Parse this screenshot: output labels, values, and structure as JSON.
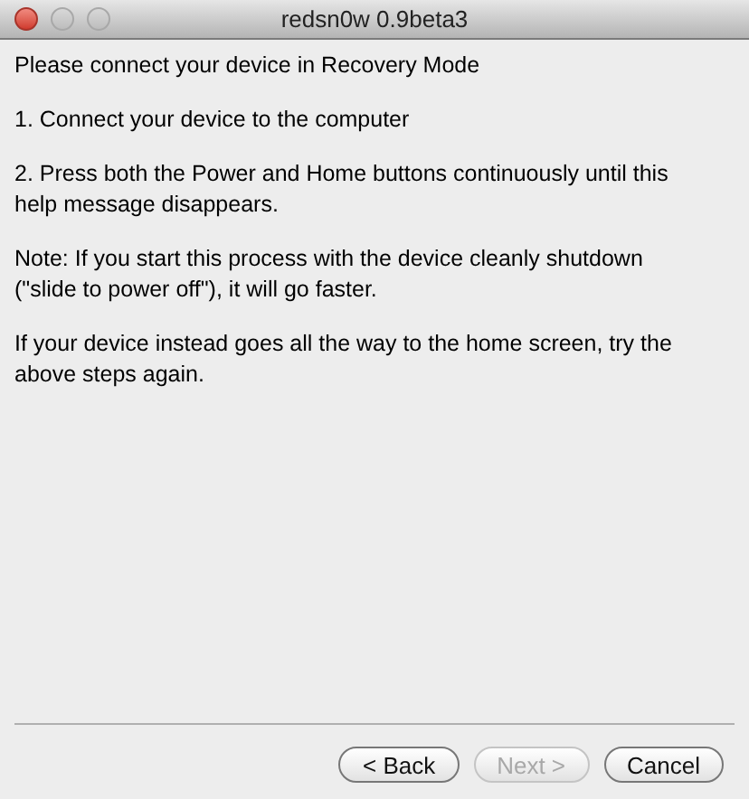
{
  "window": {
    "title": "redsn0w 0.9beta3"
  },
  "window_controls": [
    {
      "kind": "close",
      "enabled": true
    },
    {
      "kind": "minimize",
      "enabled": false
    },
    {
      "kind": "zoom",
      "enabled": false
    }
  ],
  "paragraphs": [
    "Please connect your device in Recovery Mode",
    "1. Connect your device to the computer",
    "2. Press both the Power and Home buttons continuously until this help message disappears.",
    "Note: If you start this process with the device cleanly shutdown (\"slide to power off\"), it will go faster.",
    "If your device instead goes all the way to the home screen, try the above steps again."
  ],
  "buttons": [
    {
      "label": "< Back",
      "disabled": false
    },
    {
      "label": "Next >",
      "disabled": true
    },
    {
      "label": "Cancel",
      "disabled": false
    }
  ]
}
